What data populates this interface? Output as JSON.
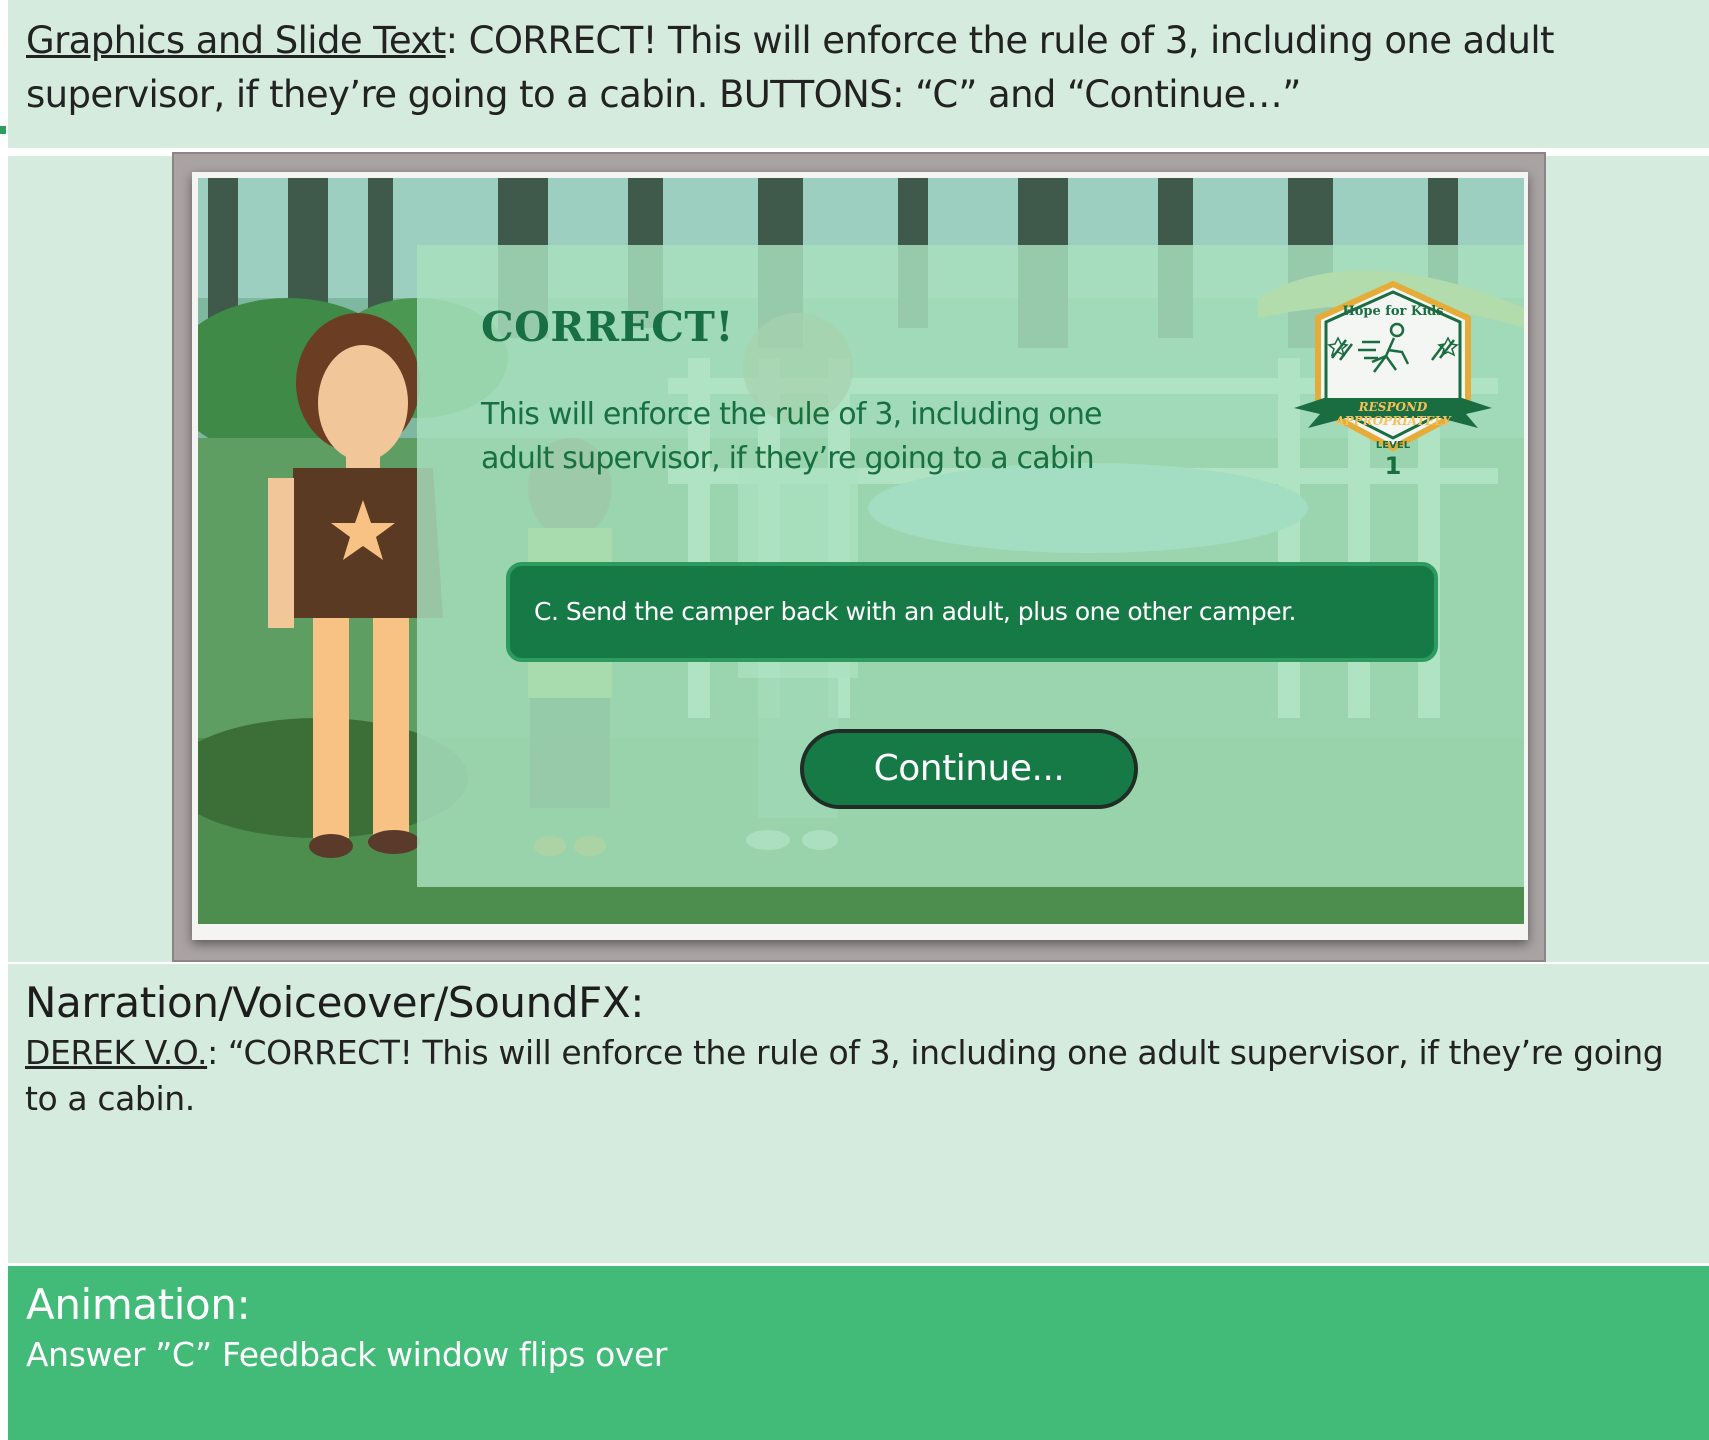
{
  "graphics_row": {
    "label": "Graphics and Slide Text",
    "separator": ":",
    "text": " CORRECT! This will enforce the rule of 3, including one adult supervisor, if they’re going to a cabin. BUTTONS: “C” and “Continue…”"
  },
  "slide": {
    "feedback_title": "CORRECT!",
    "feedback_message": "This will enforce the rule of 3, including one adult supervisor, if they’re going to a cabin",
    "answer_text": "C. Send the camper back with an adult, plus one other camper.",
    "continue_label": "Continue...",
    "badge": {
      "brand": "Hope for Kids",
      "ribbon_line1": "RESPOND",
      "ribbon_line2": "APPROPRIATELY",
      "level_label": "LEVEL",
      "level_number": "1"
    }
  },
  "narration_row": {
    "heading": "Narration/Voiceover/SoundFX:",
    "speaker": "DEREK V.O.",
    "separator": ":",
    "line": " “CORRECT! This will enforce the rule of 3, including one adult supervisor, if they’re going to a cabin."
  },
  "animation_row": {
    "heading": "Animation:",
    "text": "Answer ”C” Feedback window flips over"
  }
}
